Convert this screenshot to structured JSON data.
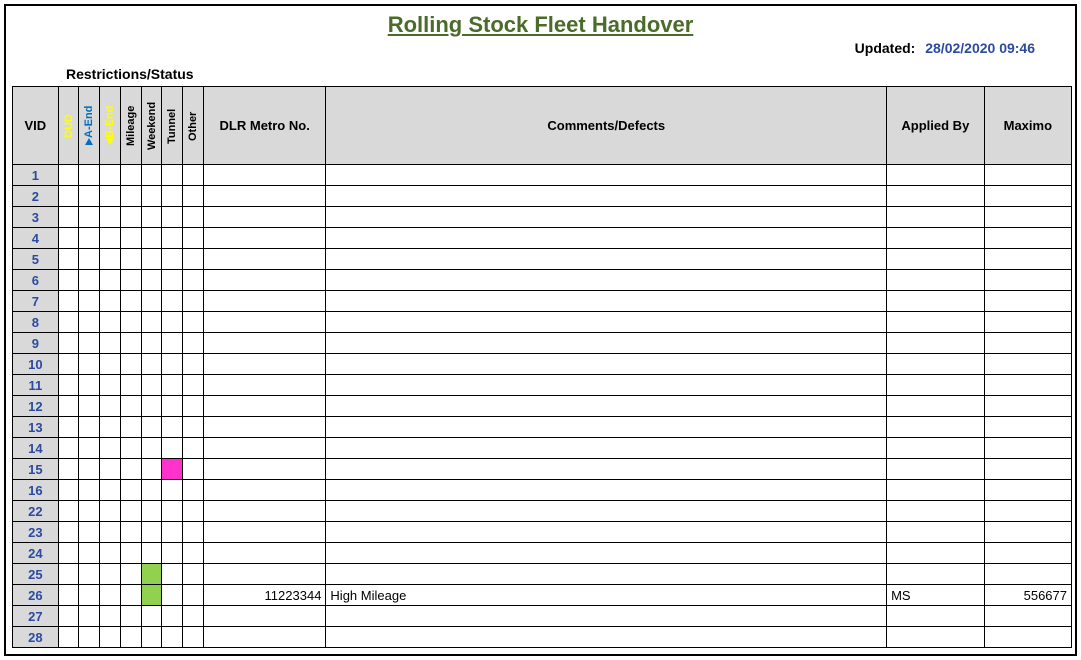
{
  "title": "Rolling Stock Fleet Handover",
  "updated_label": "Updated:",
  "updated_value": "28/02/2020 09:46",
  "restrictions_label": "Restrictions/Status",
  "headers": {
    "vid": "VID",
    "status": {
      "dud": "DUD",
      "a_end": "A-End",
      "b_end": "B-End",
      "mileage": "Mileage",
      "weekend": "Weekend",
      "tunnel": "Tunnel",
      "other": "Other"
    },
    "metro": "DLR Metro No.",
    "comments": "Comments/Defects",
    "applied_by": "Applied By",
    "maximo": "Maximo"
  },
  "rows": [
    {
      "num": "1"
    },
    {
      "num": "2"
    },
    {
      "num": "3"
    },
    {
      "num": "4"
    },
    {
      "num": "5"
    },
    {
      "num": "6"
    },
    {
      "num": "7"
    },
    {
      "num": "8"
    },
    {
      "num": "9"
    },
    {
      "num": "10"
    },
    {
      "num": "11"
    },
    {
      "num": "12"
    },
    {
      "num": "13"
    },
    {
      "num": "14"
    },
    {
      "num": "15",
      "tunnel": true
    },
    {
      "num": "16"
    },
    {
      "num": "22"
    },
    {
      "num": "23"
    },
    {
      "num": "24"
    },
    {
      "num": "25",
      "weekend": true
    },
    {
      "num": "26",
      "weekend": true,
      "metro": "11223344",
      "comments": "High Mileage",
      "applied_by": "MS",
      "maximo": "556677"
    },
    {
      "num": "27"
    },
    {
      "num": "28"
    }
  ]
}
